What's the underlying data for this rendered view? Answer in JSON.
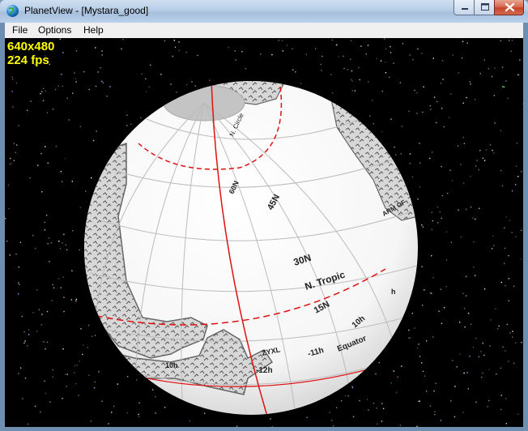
{
  "window": {
    "title": "PlanetView - [Mystara_good]"
  },
  "menu": {
    "items": [
      "File",
      "Options",
      "Help"
    ]
  },
  "overlay": {
    "resolution": "640x480",
    "fps": "224 fps"
  },
  "map_labels": {
    "n_circle": "N. Circle",
    "lat_60": "60N",
    "lat_45": "45N",
    "lat_30": "30N",
    "n_tropic": "N. Tropic",
    "lat_15": "15N",
    "equator": "Equator",
    "lon_11h": "-11h",
    "lon_10h": "10h",
    "lon_12h": "-12h",
    "lon_10h_left": "10h",
    "lon_h": "h",
    "arm": "ARM OF",
    "zyxl": "ZYXL"
  },
  "icons": {
    "app": "globe-icon",
    "minimize": "minimize-icon",
    "maximize": "maximize-icon",
    "close": "close-icon"
  },
  "colors": {
    "overlay_text": "#ffff00",
    "grid_red": "#e01010",
    "sky": "#000000"
  }
}
